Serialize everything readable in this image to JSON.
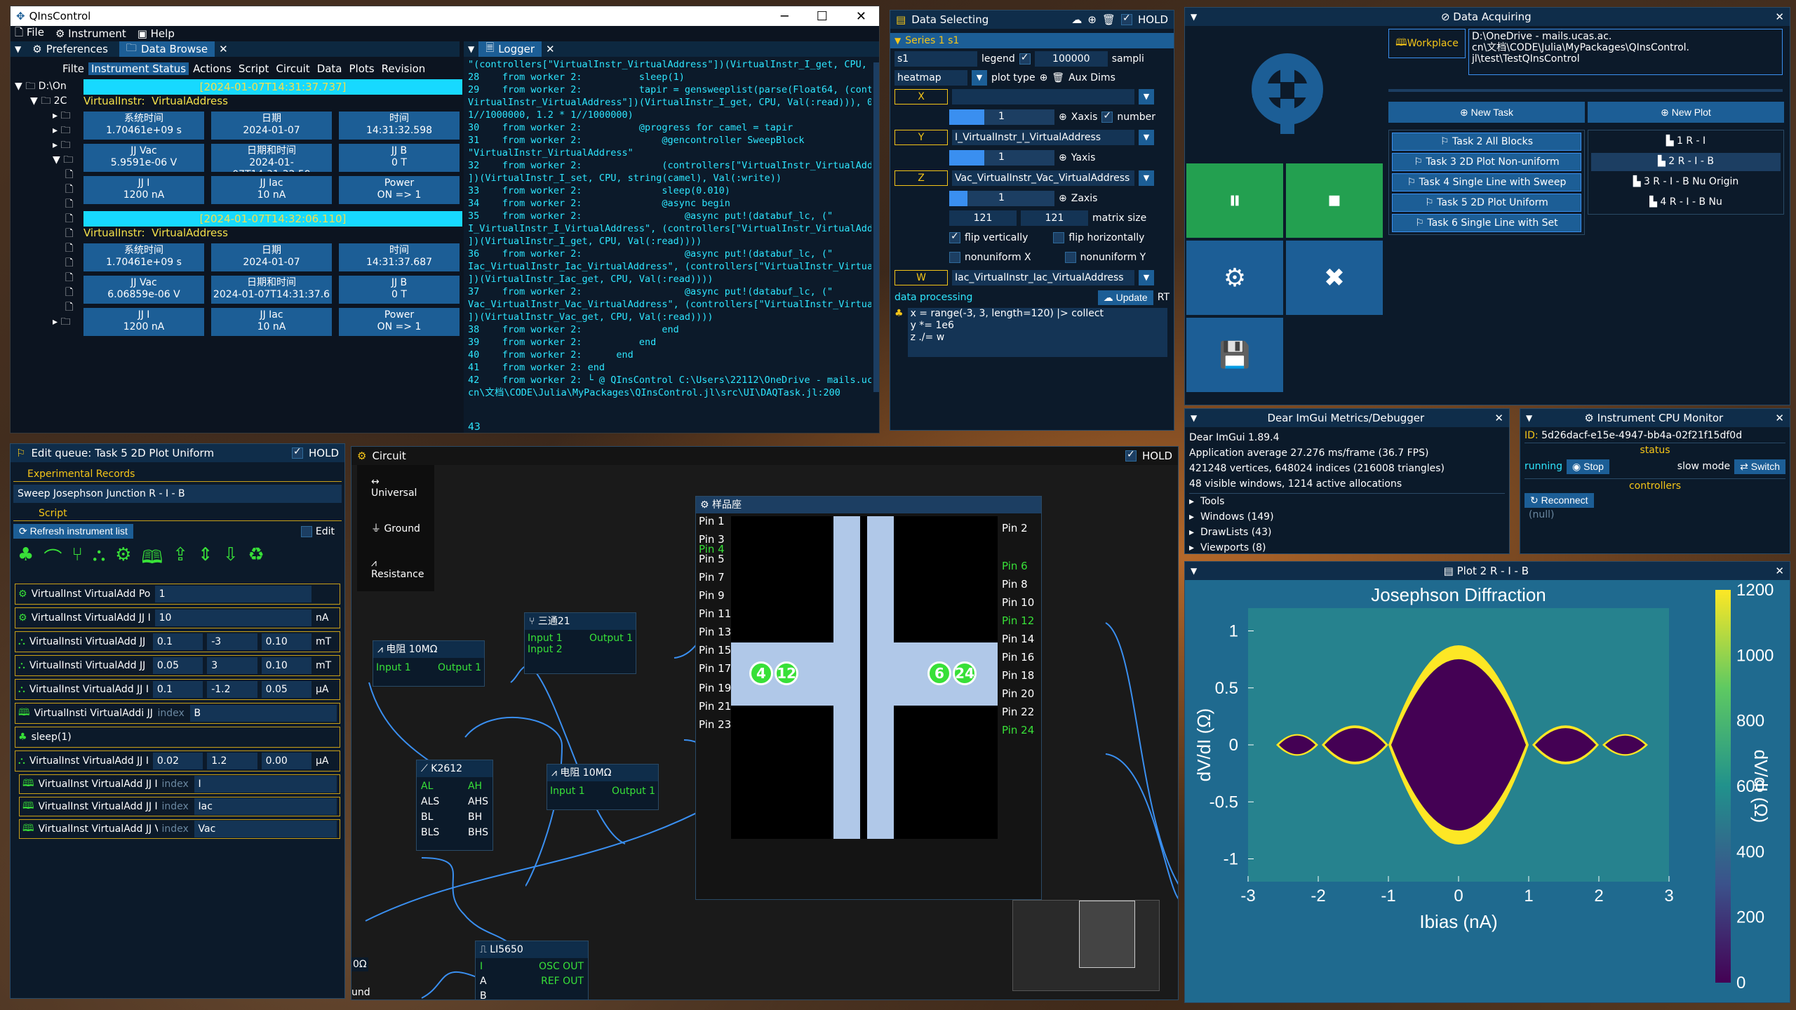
{
  "qins": {
    "title": "QInsControl",
    "menu": [
      "File",
      "Instrument",
      "Help"
    ],
    "tab_pref": "Preferences",
    "tab_browse": "Data Browse",
    "logger_title": "Logger",
    "filter_label": "Filte",
    "inst_tabs": [
      "Instrument Status",
      "Actions",
      "Script",
      "Circuit",
      "Data",
      "Plots",
      "Revision"
    ],
    "tree": [
      "D:\\On",
      "2C"
    ],
    "block1": {
      "time": "[2024-01-07T14:31:37.737]",
      "instr": "VirtualInstr:",
      "addr": "VirtualAddress",
      "cells": [
        [
          "系统时间",
          "1.70461e+09 s"
        ],
        [
          "日期",
          "2024-01-07"
        ],
        [
          "时间",
          "14:31:32.598"
        ],
        [
          "JJ Vac",
          "5.9591e-06 V"
        ],
        [
          "日期和时间",
          "2024-01-07T14:31:32.59"
        ],
        [
          "JJ B",
          "0 T"
        ],
        [
          "JJ I",
          "1200 nA"
        ],
        [
          "JJ Iac",
          "10 nA"
        ],
        [
          "Power",
          "ON => 1"
        ]
      ]
    },
    "block2": {
      "time": "[2024-01-07T14:32:06.110]",
      "instr": "VirtualInstr:",
      "addr": "VirtualAddress",
      "cells": [
        [
          "系统时间",
          "1.70461e+09 s"
        ],
        [
          "日期",
          "2024-01-07"
        ],
        [
          "时间",
          "14:31:37.687"
        ],
        [
          "JJ Vac",
          "6.06859e-06 V"
        ],
        [
          "日期和时间",
          "2024-01-07T14:31:37.6"
        ],
        [
          "JJ B",
          "0 T"
        ],
        [
          "JJ I",
          "1200 nA"
        ],
        [
          "JJ Iac",
          "10 nA"
        ],
        [
          "Power",
          "ON => 1"
        ]
      ]
    },
    "logger_text": "\"(controllers[\"VirtualInstr_VirtualAddress\"])(VirtualInstr_I_get, CPU, Val(:read))), 0.02 *\n28    from worker 2:          sleep(1)\n29    from worker 2:          tapir = gensweeplist(parse(Float64, (controllers[\"\nVirtualInstr_VirtualAddress\"])(VirtualInstr_I_get, CPU, Val(:read))), 0.02 *\n1//1000000, 1.2 * 1//1000000)\n30    from worker 2:          @progress for camel = tapir\n31    from worker 2:              @gencontroller SweepBlock\n\"VirtualInstr_VirtualAddress\"\n32    from worker 2:              (controllers[\"VirtualInstr_VirtualAddress\"\n])(VirtualInstr_I_set, CPU, string(camel), Val(:write))\n33    from worker 2:              sleep(0.010)\n34    from worker 2:              @async begin\n35    from worker 2:                  @async put!(databuf_lc, (\"\nI_VirtualInstr_I_VirtualAddress\", (controllers[\"VirtualInstr_VirtualAddress\"\n])(VirtualInstr_I_get, CPU, Val(:read))))\n36    from worker 2:                  @async put!(databuf_lc, (\"\nIac_VirtualInstr_Iac_VirtualAddress\", (controllers[\"VirtualInstr_VirtualAddress\"\n])(VirtualInstr_Iac_get, CPU, Val(:read))))\n37    from worker 2:                  @async put!(databuf_lc, (\"\nVac_VirtualInstr_Vac_VirtualAddress\", (controllers[\"VirtualInstr_VirtualAddress\"\n])(VirtualInstr_Vac_get, CPU, Val(:read))))\n38    from worker 2:              end\n39    from worker 2:          end\n40    from worker 2:      end\n41    from worker 2: end\n42    from worker 2: └ @ QInsControl C:\\Users\\22112\\OneDrive - mails.ucas.ac.\ncn\\文档\\CODE\\Julia\\MyPackages\\QInsControl.jl\\src\\UI\\DAQTask.jl:200",
    "logger_line": "43"
  },
  "dsel": {
    "title": "Data Selecting",
    "hold": "HOLD",
    "series": "Series 1 s1",
    "s1": "s1",
    "legend": "legend",
    "n": "100000",
    "sampl": "sampli",
    "plot_kind": "heatmap",
    "plot_type": "plot type",
    "aux": "Aux Dims",
    "x": "X",
    "xsel": "",
    "x_idx": "1",
    "xaxis": "Xaxis",
    "number": "number",
    "y": "Y",
    "ysel": "I_VirtualInstr_I_VirtualAddress",
    "y_idx": "1",
    "yaxis": "Yaxis",
    "z": "Z",
    "zsel": "Vac_VirtualInstr_Vac_VirtualAddress",
    "z_idx": "1",
    "zaxis": "Zaxis",
    "mx": "121",
    "my": "121",
    "msize": "matrix size",
    "flipv": "flip vertically",
    "fliph": "flip horizontally",
    "nonx": "nonuniform X",
    "nony": "nonuniform Y",
    "w": "W",
    "wsel": "Iac_VirtualInstr_Iac_VirtualAddress",
    "dp": "data processing",
    "update": "Update",
    "rt": "RT",
    "code": "x = range(-3, 3, length=120) |> collect\ny *= 1e6\nz ./= w"
  },
  "dacq": {
    "title": "Data Acquiring",
    "workplace": "Workplace",
    "path": "D:\\OneDrive - mails.ucas.ac.\ncn\\文档\\CODE\\Julia\\MyPackages\\QInsControl.\njl\\test\\TestQInsControl",
    "new_task": "New Task",
    "new_plot": "New Plot",
    "tasks": [
      "Task 2 All Blocks",
      "Task 3 2D Plot Non-uniform",
      "Task 4 Single Line with Sweep",
      "Task 5 2D Plot Uniform",
      "Task 6 Single Line with Set"
    ],
    "plots": [
      "1 R - I",
      "2 R - I - B",
      "3 R - I - B Nu Origin",
      "4 R - I - B Nu"
    ]
  },
  "metrics": {
    "title": "Dear ImGui Metrics/Debugger",
    "lines": [
      "Dear ImGui 1.89.4",
      "Application average 27.276 ms/frame (36.7 FPS)",
      "421248 vertices, 648024 indices (216008 triangles)",
      "48 visible windows, 1214 active allocations"
    ],
    "tree": [
      "Tools",
      "Windows (149)",
      "DrawLists (43)",
      "Viewports (8)"
    ]
  },
  "cpu": {
    "title": "Instrument CPU Monitor",
    "id_label": "ID:",
    "id": "5d26dacf-e15e-4947-bb4a-02f21f15df0d",
    "status": "status",
    "running": "running",
    "stop": "Stop",
    "slow": "slow mode",
    "switch": "Switch",
    "controllers": "controllers",
    "reconnect": "Reconnect",
    "null": "(null)"
  },
  "edq": {
    "title": "Edit queue: Task 5 2D Plot Uniform",
    "hold": "HOLD",
    "exp": "Experimental Records",
    "record": "Sweep Josephson Junction R - I - B",
    "script": "Script",
    "refresh": "Refresh instrument list",
    "edit": "Edit",
    "rows": [
      {
        "a": "VirtualInst",
        "b": "VirtualAdd",
        "c": "Power",
        "v": "1",
        "u": ""
      },
      {
        "a": "VirtualInst",
        "b": "VirtualAdd",
        "c": "JJ Iac",
        "v": "10",
        "u": "nA"
      },
      {
        "a": "VirtualInsti",
        "b": "VirtualAdd",
        "c": "JJ B",
        "v": "0.1",
        "w": "-3",
        "x": "0.10",
        "u": "mT"
      },
      {
        "a": "VirtualInsti",
        "b": "VirtualAdd",
        "c": "JJ B",
        "v": "0.05",
        "w": "3",
        "x": "0.10",
        "u": "mT"
      },
      {
        "a": "VirtualInst",
        "b": "VirtualAdd",
        "c": "JJ I",
        "v": "0.1",
        "w": "-1.2",
        "x": "0.05",
        "u": "μA"
      },
      {
        "a": "VirtualInsti",
        "b": "VirtualAddi",
        "c": "JJ B",
        "idx": "index",
        "v": "B"
      },
      {
        "a": "sleep(1)"
      },
      {
        "a": "VirtualInst",
        "b": "VirtualAdd",
        "c": "JJ I",
        "v": "0.02",
        "w": "1.2",
        "x": "0.00",
        "u": "μA"
      },
      {
        "a": "VirtualInst",
        "b": "VirtualAdd",
        "c": "JJ I",
        "idx": "index",
        "v": "I"
      },
      {
        "a": "VirtualInst",
        "b": "VirtualAdd",
        "c": "JJ Iac",
        "idx": "index",
        "v": "Iac"
      },
      {
        "a": "VirtualInst",
        "b": "VirtualAdd",
        "c": "JJ Vac",
        "idx": "index",
        "v": "Vac"
      }
    ]
  },
  "circ": {
    "title": "Circuit",
    "hold": "HOLD",
    "palette": [
      "Universal",
      "Ground",
      "Resistance"
    ],
    "res1": "电阻 10MΩ",
    "res2": "电阻 10MΩ",
    "in1": "Input 1",
    "out1": "Output 1",
    "tee": "三通21",
    "in2": "Input 2",
    "k": "K2612",
    "kpins": [
      "AL",
      "ALS",
      "BL",
      "BLS"
    ],
    "kpins2": [
      "AH",
      "AHS",
      "BH",
      "BHS"
    ],
    "li": "LI5650",
    "lipins": [
      "I",
      "A",
      "B"
    ],
    "liout": [
      "OSC OUT",
      "REF OUT"
    ],
    "sample": "样品座",
    "lpins": [
      "Pin 1",
      "Pin 3",
      "Pin 4",
      "Pin 5",
      "Pin 7",
      "Pin 9",
      "Pin 11",
      "Pin 13",
      "Pin 15",
      "Pin 17",
      "Pin 19",
      "Pin 21",
      "Pin 23"
    ],
    "rpins": [
      "Pin 2",
      "Pin 6",
      "Pin 8",
      "Pin 10",
      "Pin 12",
      "Pin 14",
      "Pin 16",
      "Pin 18",
      "Pin 20",
      "Pin 22",
      "Pin 24"
    ],
    "circles": [
      "4",
      "12",
      "6",
      "24"
    ],
    "edge": [
      "0Ω",
      "und"
    ]
  },
  "plot": {
    "title": "Plot 2 R - I - B"
  },
  "chart_data": {
    "type": "heatmap",
    "title": "Josephson Diffraction",
    "xlabel": "Ibias (nA)",
    "ylabel": "dV/dI (Ω)",
    "colorbar_label": "dV/dI (Ω)",
    "xlim": [
      -3,
      3
    ],
    "ylim": [
      -1.2,
      1.2
    ],
    "xticks": [
      "-3",
      "-2",
      "-1",
      "0",
      "1",
      "2",
      "3"
    ],
    "yticks": [
      "1",
      "0.5",
      "0",
      "-0.5",
      "-1"
    ],
    "colorbar_ticks": [
      "1200",
      "1000",
      "800",
      "600",
      "400",
      "200",
      "0"
    ],
    "clim": [
      0,
      1200
    ],
    "colormap": "viridis"
  }
}
